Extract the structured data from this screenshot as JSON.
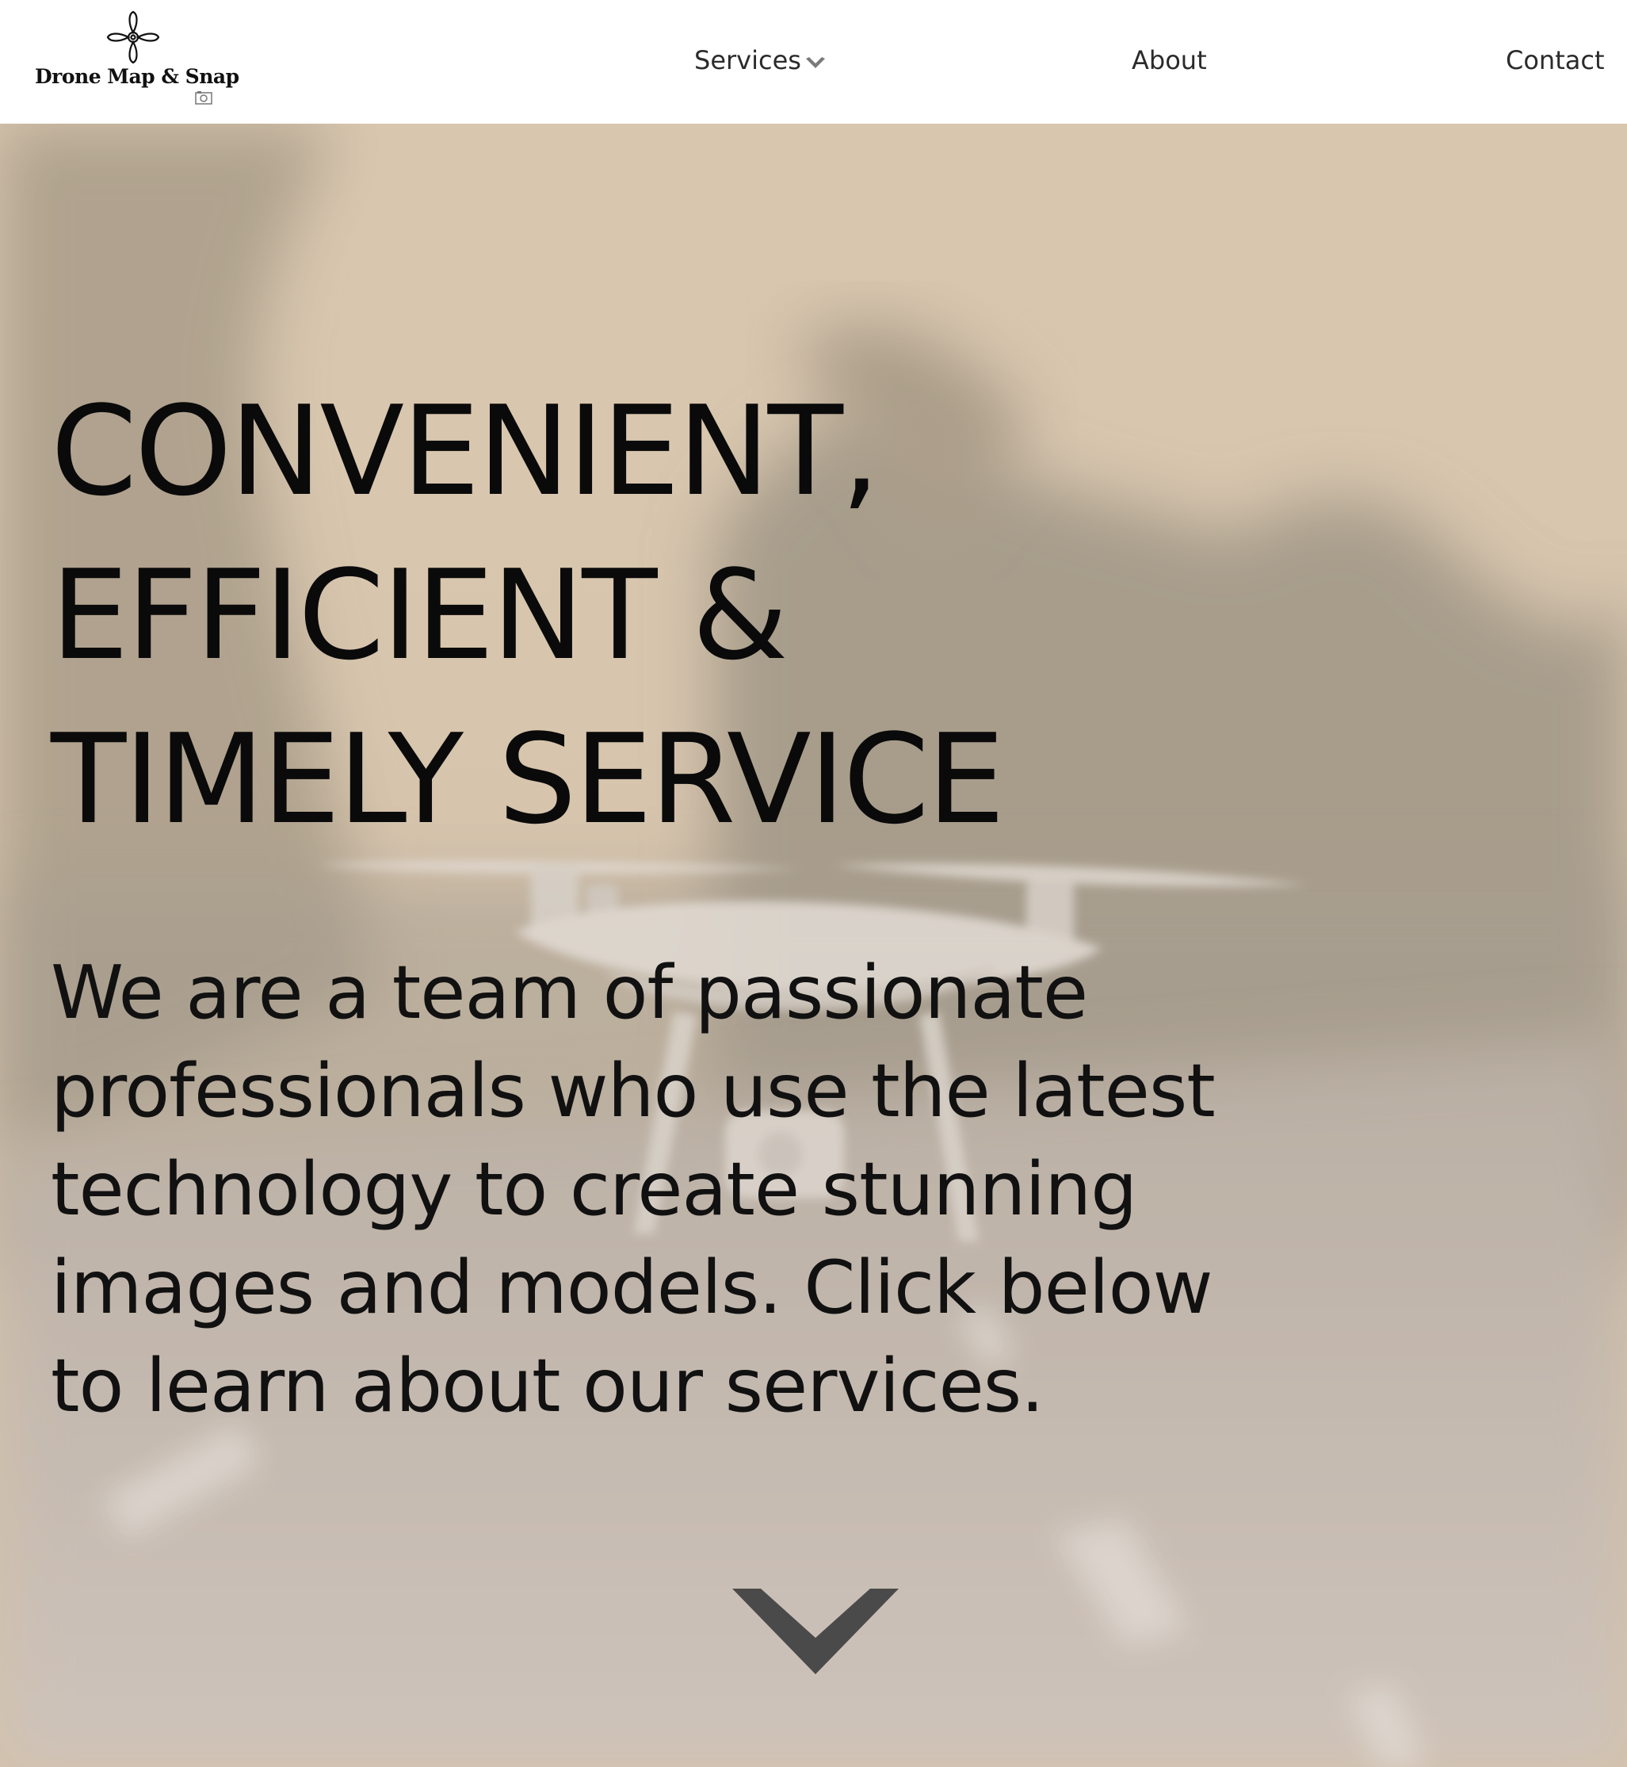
{
  "header": {
    "logo": {
      "text": "Drone Map & Snap",
      "mark_icon": "drone-propeller-icon",
      "sub_icon": "camera-icon"
    },
    "nav": [
      {
        "label": "Services",
        "has_dropdown": true,
        "dropdown_icon": "chevron-down-icon"
      },
      {
        "label": "About"
      },
      {
        "label": "Contact"
      }
    ]
  },
  "hero": {
    "title_lines": [
      "CONVENIENT,",
      "EFFICIENT &",
      "TIMELY SERVICE"
    ],
    "body_lines": [
      "We are a team of passionate",
      "professionals who use the latest",
      "technology to create stunning",
      "images and models. Click below",
      "to learn about our services."
    ],
    "scroll_icon": "chevron-down-icon"
  },
  "colors": {
    "header_bg": "#ffffff",
    "nav_text": "#2b2b2b",
    "hero_text": "#0a0a0a",
    "scroll_chevron": "#4a4a4a",
    "hero_overlay": "#cdbca6"
  }
}
